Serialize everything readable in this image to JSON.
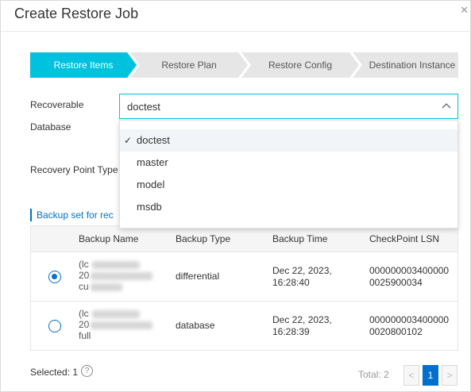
{
  "dialog": {
    "title": "Create Restore Job",
    "close_icon": "close-icon"
  },
  "steps": [
    {
      "label": "Restore Items",
      "active": true
    },
    {
      "label": "Restore Plan",
      "active": false
    },
    {
      "label": "Restore Config",
      "active": false
    },
    {
      "label": "Destination Instance",
      "active": false
    }
  ],
  "form": {
    "recoverable_label_line1": "Recoverable",
    "recoverable_label_line2": "Database",
    "database_select_value": "doctest",
    "recovery_point_label": "Recovery Point Type",
    "dropdown_options": [
      {
        "label": "doctest",
        "selected": true
      },
      {
        "label": "master",
        "selected": false
      },
      {
        "label": "model",
        "selected": false
      },
      {
        "label": "msdb",
        "selected": false
      }
    ]
  },
  "backup_section": {
    "title": "Backup set for rec"
  },
  "table": {
    "headers": [
      "Backup Name",
      "Backup Type",
      "Backup Time",
      "CheckPoint LSN"
    ],
    "rows": [
      {
        "checked": true,
        "name_visible": [
          "(lc",
          "20",
          "cu"
        ],
        "type": "differential",
        "time_line1": "Dec 22, 2023,",
        "time_line2": "16:28:40",
        "lsn_line1": "000000003400000",
        "lsn_line2": "0025900034"
      },
      {
        "checked": false,
        "name_visible": [
          "(lc",
          "20",
          "full"
        ],
        "type": "database",
        "time_line1": "Dec 22, 2023,",
        "time_line2": "16:28:39",
        "lsn_line1": "000000003400000",
        "lsn_line2": "0020800102"
      }
    ]
  },
  "footer": {
    "selected_text": "Selected: 1",
    "help_icon": "?",
    "total_text": "Total: 2",
    "prev": "<",
    "page": "1",
    "next": ">"
  },
  "colors": {
    "accent": "#00c1de",
    "primary": "#0070cc"
  }
}
